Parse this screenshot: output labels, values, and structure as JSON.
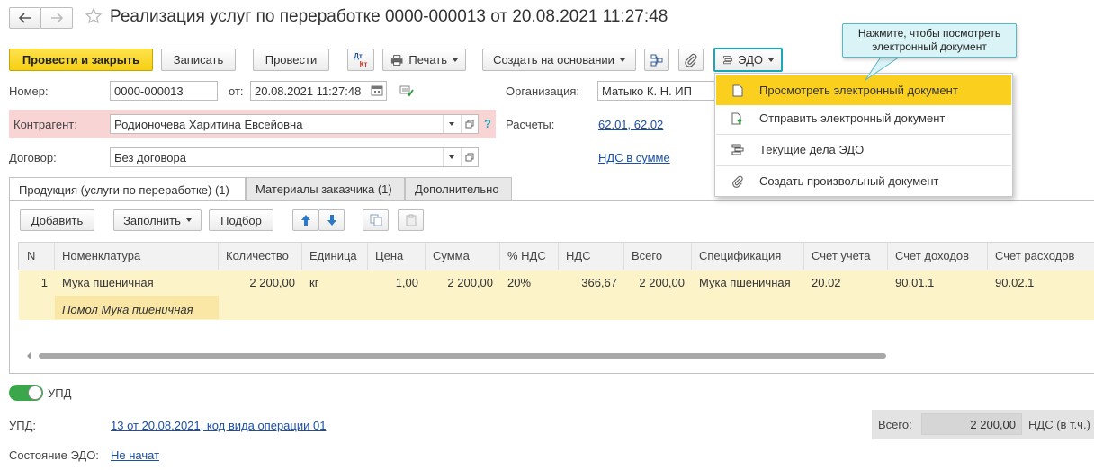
{
  "window": {
    "title": "Реализация услуг по переработке 0000-000013 от 20.08.2021 11:27:48"
  },
  "toolbar": {
    "post_close": "Провести и закрыть",
    "save": "Записать",
    "post": "Провести",
    "dtkt_dt": "Дт",
    "dtkt_kt": "Кт",
    "print": "Печать",
    "create_based": "Создать на основании",
    "edo": "ЭДО"
  },
  "tooltip": {
    "text": "Нажмите, чтобы посмотреть электронный документ"
  },
  "form": {
    "number_label": "Номер:",
    "number_value": "0000-000013",
    "date_label": "от:",
    "date_value": "20.08.2021 11:27:48",
    "org_label": "Организация:",
    "org_value": "Матыко К. Н. ИП",
    "counterparty_label": "Контрагент:",
    "counterparty_value": "Родионочева Харитина Евсейовна",
    "help_mark": "?",
    "settlements_label": "Расчеты:",
    "settlements_link": "62.01, 62.02",
    "contract_label": "Договор:",
    "contract_value": "Без договора",
    "vat_link": "НДС в сумме"
  },
  "edo_menu": {
    "items": [
      {
        "label": "Просмотреть электронный документ"
      },
      {
        "label": "Отправить электронный документ"
      },
      {
        "label": "Текущие дела ЭДО"
      },
      {
        "label": "Создать произвольный документ"
      }
    ]
  },
  "tabs": [
    {
      "label": "Продукция (услуги по переработке) (1)"
    },
    {
      "label": "Материалы заказчика (1)"
    },
    {
      "label": "Дополнительно"
    }
  ],
  "table_toolbar": {
    "add": "Добавить",
    "fill": "Заполнить",
    "select": "Подбор"
  },
  "table": {
    "columns": [
      "N",
      "Номенклатура",
      "Количество",
      "Единица",
      "Цена",
      "Сумма",
      "% НДС",
      "НДС",
      "Всего",
      "Спецификация",
      "Счет учета",
      "Счет доходов",
      "Счет расходов"
    ],
    "rows": [
      {
        "n": "1",
        "item": "Мука пшеничная",
        "subitem": "Помол Мука пшеничная",
        "qty": "2 200,00",
        "unit": "кг",
        "price": "1,00",
        "sum": "2 200,00",
        "vat_rate": "20%",
        "vat": "366,67",
        "total": "2 200,00",
        "spec": "Мука пшеничная",
        "account": "20.02",
        "income": "90.01.1",
        "expense": "90.02.1"
      }
    ]
  },
  "footer": {
    "upd_toggle": "УПД",
    "upd_label": "УПД:",
    "upd_link": "13 от 20.08.2021, код вида операции 01",
    "total_label": "Всего:",
    "total_value": "2 200,00",
    "vat_label": "НДС (в т.ч.)",
    "edo_state_label": "Состояние ЭДО:",
    "edo_state_link": "Не начат"
  },
  "colors": {
    "primary_button": "#f5cf11",
    "highlight_row": "#fdf3c8",
    "menu_selected": "#fbcf1e",
    "tooltip_bg": "#d9f3f6",
    "link": "#1a4fa3",
    "counterparty_bg": "#f9d4d4"
  }
}
